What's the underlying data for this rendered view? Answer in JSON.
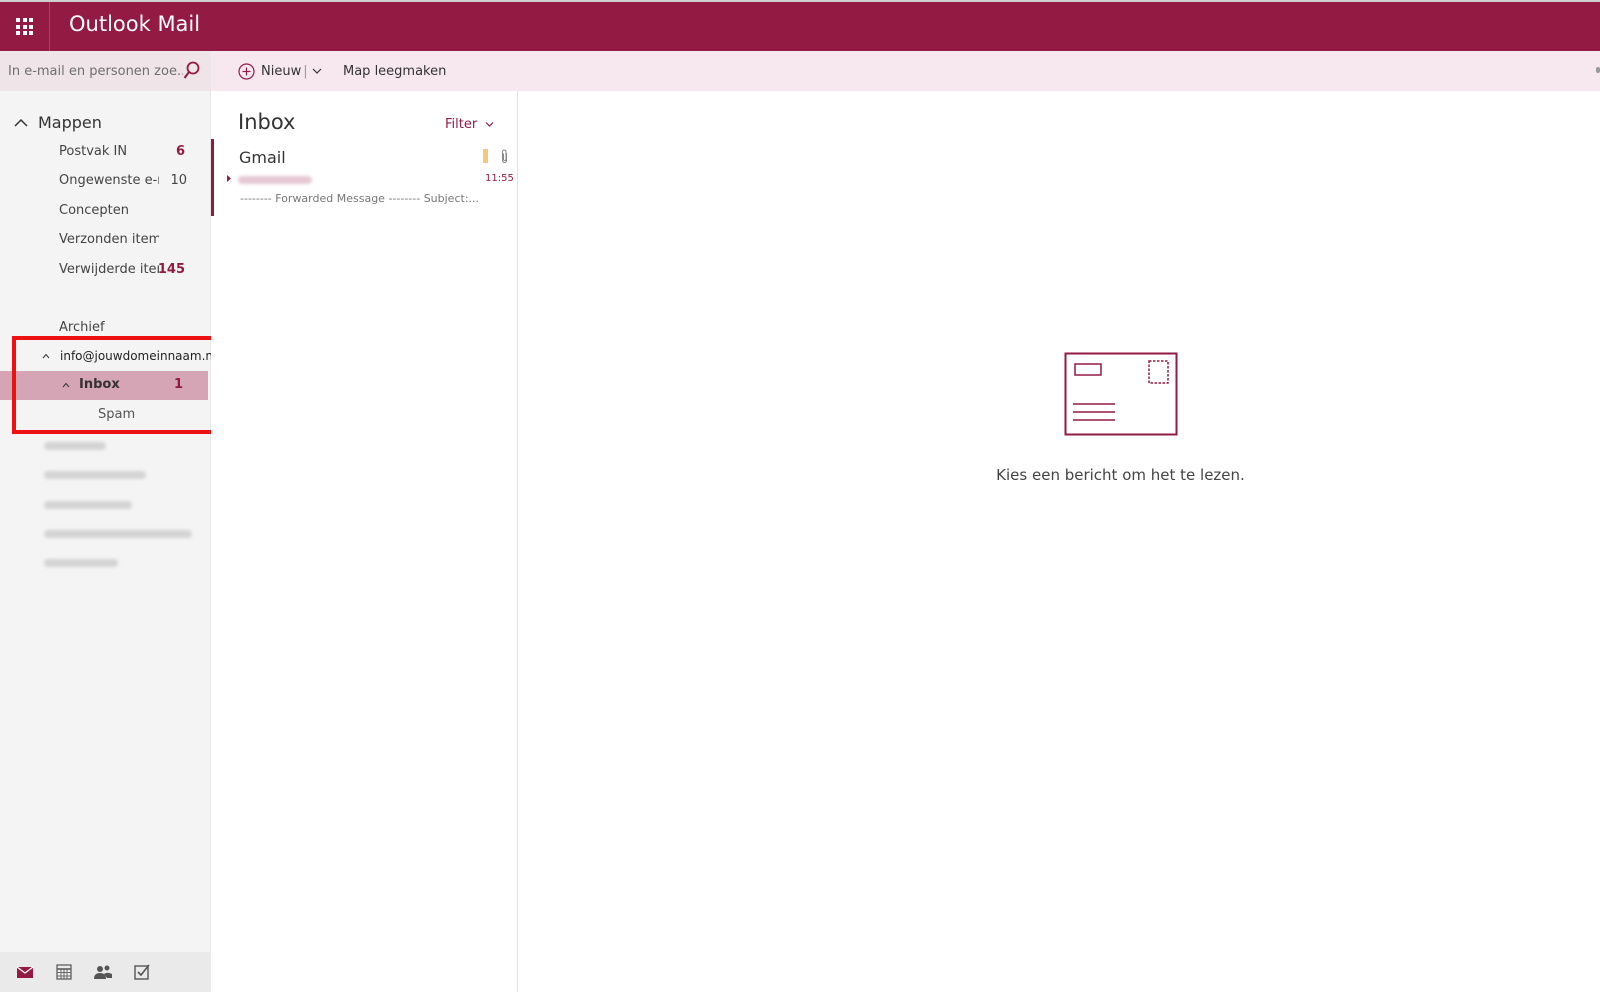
{
  "app": {
    "title": "Outlook Mail"
  },
  "search": {
    "placeholder": "In e-mail en personen zoe..."
  },
  "commands": {
    "new_label": "Nieuw",
    "new_separator": "|",
    "empty_folder_label": "Map leegmaken"
  },
  "nav": {
    "section_label": "Mappen",
    "folders": [
      {
        "name": "Postvak IN",
        "count": "6"
      },
      {
        "name": "Ongewenste e-m",
        "count": "10"
      },
      {
        "name": "Concepten",
        "count": ""
      },
      {
        "name": "Verzonden items",
        "count": ""
      },
      {
        "name": "Verwijderde iter",
        "count": "145"
      },
      {
        "name": "Archief",
        "count": ""
      }
    ],
    "account": "info@jouwdomeinnaam.nl",
    "selected_folder": {
      "name": "Inbox",
      "count": "1"
    },
    "subfolder": "Spam"
  },
  "message_list": {
    "title": "Inbox",
    "filter_label": "Filter",
    "messages": [
      {
        "sender": "Gmail",
        "time": "11:55",
        "preview": "-------- Forwarded Message -------- Subject:..."
      }
    ]
  },
  "reading_pane": {
    "empty_text": "Kies een bericht om het te lezen."
  },
  "colors": {
    "brand": "#931a43",
    "selected": "#d5a4b5",
    "highlight": "#ee1111"
  }
}
